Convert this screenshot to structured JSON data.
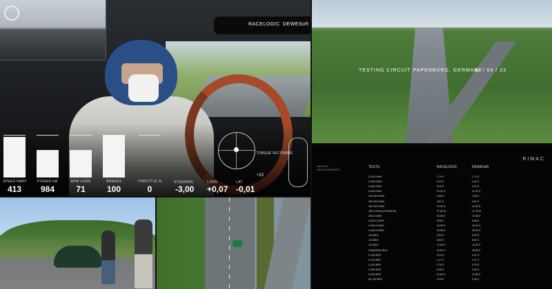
{
  "cockpit": {
    "brand_left": "RACELOGIC",
    "brand_right": "DEWESoft",
    "gauges": [
      {
        "label": "SPEED KM/H",
        "value": "413",
        "fill": 0.95
      },
      {
        "label": "POWER kW",
        "value": "984",
        "fill": 0.65
      },
      {
        "label": "RPM x1000",
        "value": "71",
        "fill": 0.65
      },
      {
        "label": "BRAKES",
        "value": "100",
        "fill": 1.0
      },
      {
        "label": "THROTTLE %",
        "value": "0",
        "fill": 0.0
      }
    ],
    "telemetry": [
      {
        "label": "STEERING",
        "value": "-3,00"
      },
      {
        "label": "LONG",
        "value": "+0,07"
      },
      {
        "label": "LAT",
        "value": "-0,01"
      }
    ],
    "torque_label": "TORQUE VECTORING",
    "torque_value": "+22"
  },
  "aerial": {
    "caption_left": "TESTING CIRCUIT PAPENBURG, GERMANY",
    "caption_right": "30 / 04 / 23"
  },
  "results": {
    "brand": "RIMAC",
    "measurements_label": "NEVERA MEASUREMENTS",
    "col_tests": "TESTS",
    "col_racelogic": "RACELOGIC",
    "col_dewesoft": "DEWESoft",
    "rows": [
      [
        "0-100 KM/H",
        "1.74 S",
        "1.74 S"
      ],
      [
        "0-200 KM/H",
        "4.42 S",
        "4.42 S"
      ],
      [
        "0-300 KM/H",
        "9.22 S",
        "9.23 S"
      ],
      [
        "0-400 KM/H",
        "21.31 S",
        "21.31 S"
      ],
      [
        "100-200 KM/H",
        "2.68 S",
        "2.68 S"
      ],
      [
        "200-300 KM/H",
        "4.81 S",
        "4.81 S"
      ],
      [
        "300-400 KM/H",
        "12.09 S",
        "12.09 S"
      ],
      [
        "300-0 KM/H (DISTANCE)",
        "27.52 M",
        "27.76 M"
      ],
      [
        "200-0 KM/H",
        "10.58 S",
        "10.58 S"
      ],
      [
        "0-200-0 KM/H",
        "8.96 S",
        "8.96 S"
      ],
      [
        "0-300-0 KM/H",
        "15.50 S",
        "15.50 S"
      ],
      [
        "0-400-0 KM/H",
        "29.93 S",
        "29.93 S"
      ],
      [
        "1/8 MILE",
        "5.93 S",
        "5.93 S"
      ],
      [
        "1/4 MILE",
        "8.62 S",
        "8.62 S"
      ],
      [
        "1/2 MILE",
        "12.82 S",
        "12.82 S"
      ],
      [
        "STANDING MILE",
        "20.51 S",
        "20.53 S"
      ],
      [
        "0-100 MPH",
        "3.21 S",
        "3.21 S"
      ],
      [
        "0-120 MPH",
        "4.17 S",
        "4.17 S"
      ],
      [
        "0-150 MPH",
        "4.75 S",
        "4.75 S"
      ],
      [
        "0-200 MPH",
        "9.08 S",
        "9.08 S"
      ],
      [
        "0-250 MPH",
        "21.89 S",
        "21.89 S"
      ],
      [
        "60-130 MPH",
        "2.49 S",
        "2.49 S"
      ]
    ]
  }
}
